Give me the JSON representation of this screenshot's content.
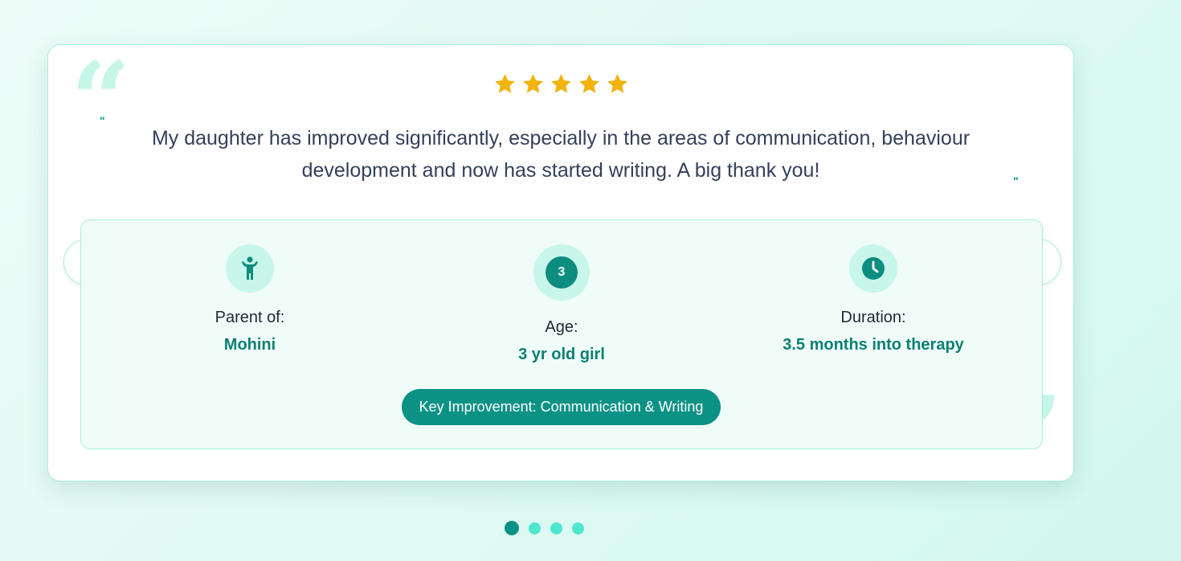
{
  "testimonial": {
    "rating": 5,
    "quote_open_glyph": "“",
    "quote_close_glyph": "”",
    "small_quote_glyph": "\"",
    "text": "My daughter has improved significantly, especially in the areas of communication, behaviour development and now has started writing. A big thank you!",
    "parent": {
      "label": "Parent of:",
      "value": "Mohini",
      "icon": "child-icon"
    },
    "age": {
      "badge": "3",
      "label": "Age:",
      "value": "3 yr old girl"
    },
    "duration": {
      "label": "Duration:",
      "value": "3.5 months into therapy",
      "icon": "clock-icon"
    },
    "key_improvement": "Key Improvement: Communication & Writing"
  },
  "pagination": {
    "count": 4,
    "active_index": 0
  },
  "colors": {
    "accent": "#0c9285",
    "accent_dark": "#0c7f74",
    "star": "#f2b30c",
    "dot_inactive": "#4ee6cf",
    "panel_bg": "#effcf8",
    "icon_circle": "#c8f6ea"
  }
}
